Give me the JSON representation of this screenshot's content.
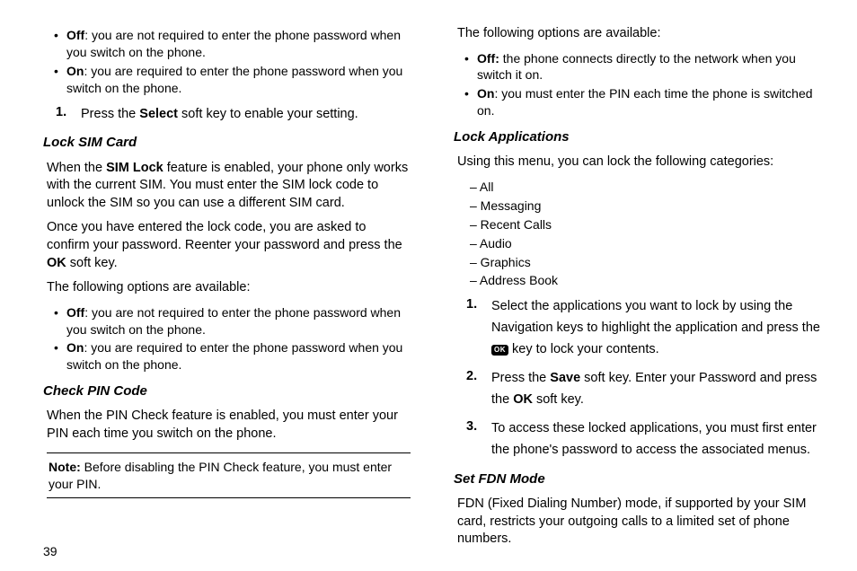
{
  "pageNumber": "39",
  "left": {
    "bullets1": [
      {
        "lead": "Off",
        "text": ": you are not required to enter the phone password when you switch on the phone."
      },
      {
        "lead": "On",
        "text": ": you are required to enter the phone password when you switch on the phone."
      }
    ],
    "step1Num": "1.",
    "step1_a": "Press the ",
    "step1_b": "Select",
    "step1_c": " soft key to enable your setting.",
    "h_lockSim": "Lock SIM Card",
    "lockSim_p1_a": "When the ",
    "lockSim_p1_b": "SIM Lock",
    "lockSim_p1_c": " feature is enabled, your phone only works with the current SIM. You must enter the SIM lock code to unlock the SIM so you can use a different SIM card.",
    "lockSim_p2_a": "Once you have entered the lock code, you are asked to confirm your password. Reenter your password and press the ",
    "lockSim_p2_b": "OK",
    "lockSim_p2_c": " soft key.",
    "optionsIntro": "The following options are available:",
    "bullets2": [
      {
        "lead": "Off",
        "text": ": you are not required to enter the phone password when you switch on the phone."
      },
      {
        "lead": "On",
        "text": ": you are required to enter the phone password when you switch on the phone."
      }
    ],
    "h_checkPin": "Check PIN Code",
    "checkPin_p": "When the PIN Check feature is enabled, you must enter your PIN each time you switch on the phone.",
    "note_lead": "Note:",
    "note_text": " Before disabling the PIN Check feature, you must enter your PIN."
  },
  "right": {
    "optionsIntro": "The following options are available:",
    "bullets": [
      {
        "lead": "Off:",
        "text": " the phone connects directly to the network when you switch it on."
      },
      {
        "lead": "On",
        "text": ": you must enter the PIN each time the phone is switched on."
      }
    ],
    "h_lockApps": "Lock Applications",
    "lockApps_intro": "Using this menu, you can lock the following categories:",
    "dashItems": [
      "– All",
      "– Messaging",
      "– Recent Calls",
      "– Audio",
      "– Graphics",
      "– Address Book"
    ],
    "step1_num": "1.",
    "step1_a": "Select the applications you want to lock by using the Navigation keys to highlight the application and press the ",
    "step1_b": " key to lock your contents.",
    "step2_num": "2.",
    "step2_a": "Press the ",
    "step2_b": "Save",
    "step2_c": " soft key. Enter your Password and press the ",
    "step2_d": "OK",
    "step2_e": " soft key.",
    "step3_num": "3.",
    "step3": "To access these locked applications, you must first enter the phone's password to access the associated menus.",
    "h_fdn": "Set FDN Mode",
    "fdn_p": "FDN (Fixed Dialing Number) mode, if supported by your SIM card, restricts your outgoing calls to a limited set of phone numbers."
  }
}
